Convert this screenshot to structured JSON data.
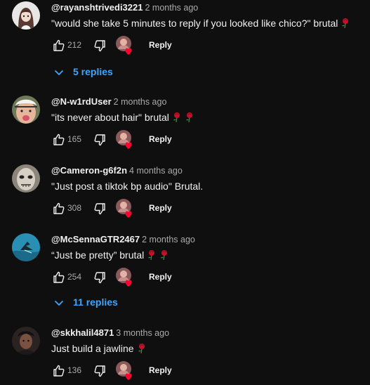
{
  "comments": [
    {
      "author": "@rayanshtrivedi3221",
      "time": "2 months ago",
      "text": "\"would she take 5 minutes to reply if you looked like chico?\" brutal",
      "roses": 1,
      "likes": "212",
      "reply_label": "Reply",
      "replies_label": "5 replies",
      "avatar_icon": "anime-girl-avatar",
      "avatar_bg": "#e8e4e4"
    },
    {
      "author": "@N-w1rdUser",
      "time": "2 months ago",
      "text": "\"its never about hair\" brutal",
      "roses": 2,
      "likes": "165",
      "reply_label": "Reply",
      "avatar_icon": "face-tongue-avatar",
      "avatar_bg": "#6f7a5a"
    },
    {
      "author": "@Cameron-g6f2n",
      "time": "4 months ago",
      "text": "\"Just post a tiktok bp audio\" Brutal.",
      "roses": 0,
      "likes": "308",
      "reply_label": "Reply",
      "avatar_icon": "masked-face-avatar",
      "avatar_bg": "#c9c2b8"
    },
    {
      "author": "@McSennaGTR2467",
      "time": "2 months ago",
      "text": "“Just be pretty” brutal",
      "roses": 2,
      "likes": "254",
      "reply_label": "Reply",
      "replies_label": "11 replies",
      "avatar_icon": "bird-on-water-avatar",
      "avatar_bg": "#2a8fb5"
    },
    {
      "author": "@skkhalil4871",
      "time": "3 months ago",
      "text": "Just build a jawline",
      "roses": 1,
      "likes": "136",
      "reply_label": "Reply",
      "avatar_icon": "dark-portrait-avatar",
      "avatar_bg": "#2b2322"
    }
  ],
  "colors": {
    "background": "#0f0f0f",
    "link_blue": "#3ea6ff",
    "heart_red": "#ff0033"
  }
}
